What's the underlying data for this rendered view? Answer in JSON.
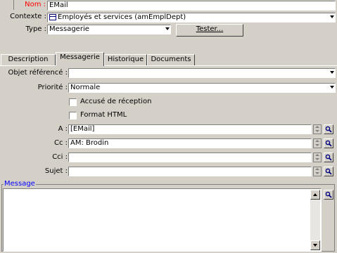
{
  "header": {
    "name_label": "Nom :",
    "name_value": "EMail",
    "context_label": "Contexte :",
    "context_value": "Employés et services (amEmplDept)",
    "type_label": "Type :",
    "type_value": "Messagerie",
    "test_button": "Tester..."
  },
  "tabs": [
    {
      "label": "Description"
    },
    {
      "label": "Messagerie"
    },
    {
      "label": "Historique"
    },
    {
      "label": "Documents"
    }
  ],
  "active_tab": "Messagerie",
  "form": {
    "ref_object_label": "Objet référencé :",
    "ref_object_value": "",
    "priority_label": "Priorité :",
    "priority_value": "Normale",
    "receipt_label": "Accusé de réception",
    "html_label": "Format HTML",
    "to_label": "A :",
    "to_value": "[EMail]",
    "cc_label": "Cc :",
    "cc_value": "AM: Brodin",
    "bcc_label": "Cci :",
    "bcc_value": "",
    "subject_label": "Sujet :",
    "subject_value": "",
    "message_label": "Message",
    "message_value": ""
  },
  "colors": {
    "background": "#d4d0c8",
    "name_label": "#ff0000",
    "message_label": "#0000ff",
    "lens_icon": "#000080"
  },
  "icons": [
    "table-icon",
    "dropdown-arrow-icon",
    "spin-icon",
    "magnifier-icon"
  ]
}
